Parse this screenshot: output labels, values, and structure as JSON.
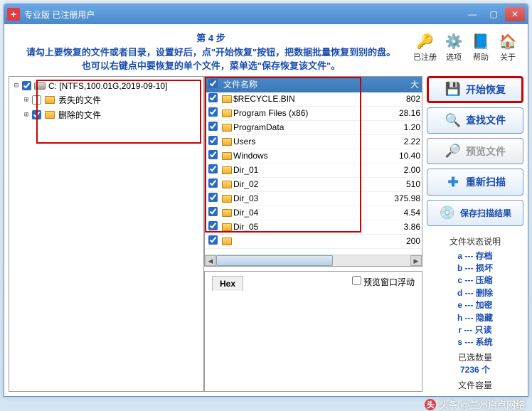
{
  "titlebar": {
    "text": "专业版  已注册用户"
  },
  "toolbar": {
    "registered": "已注册",
    "options": "选项",
    "help": "帮助",
    "about": "关于"
  },
  "instructions": {
    "step": "第 4 步",
    "line1": "请勾上要恢复的文件或者目录，设置好后，点\"开始恢复\"按钮，把数据批量恢复到别的盘。",
    "line2": "也可以右键点中要恢复的单个文件，菜单选\"保存恢复该文件\"。"
  },
  "tree": {
    "drive": "C:  [NTFS,100.01G,2019-09-10]",
    "lost": "丢失的文件",
    "deleted": "删除的文件"
  },
  "file_header": {
    "name": "文件名称",
    "size": "大"
  },
  "files": [
    {
      "name": "$RECYCLE.BIN",
      "size": "802"
    },
    {
      "name": "Program Files (x86)",
      "size": "28.16"
    },
    {
      "name": "ProgramData",
      "size": "1.20"
    },
    {
      "name": "Users",
      "size": "2.22"
    },
    {
      "name": "Windows",
      "size": "10.40"
    },
    {
      "name": "Dir_01",
      "size": "2.00"
    },
    {
      "name": "Dir_02",
      "size": "510"
    },
    {
      "name": "Dir_03",
      "size": "375.98"
    },
    {
      "name": "Dir_04",
      "size": "4.54"
    },
    {
      "name": "Dir_05",
      "size": "3.86"
    },
    {
      "name": "",
      "size": "200"
    }
  ],
  "preview": {
    "tab": "Hex",
    "float": "预览窗口浮动"
  },
  "actions": {
    "start": "开始恢复",
    "find": "查找文件",
    "preview": "预览文件",
    "rescan": "重新扫描",
    "save": "保存扫描结果"
  },
  "legend": {
    "title": "文件状态说明",
    "items": [
      "a --- 存档",
      "b --- 损坏",
      "c --- 压缩",
      "d --- 删除",
      "e --- 加密",
      "h --- 隐藏",
      "r --- 只读",
      "s --- 系统"
    ],
    "sel_count_label": "已选数量",
    "sel_count": "7236 个",
    "sel_size_label": "文件容量"
  },
  "watermark": "头条 @兰州启点网络"
}
